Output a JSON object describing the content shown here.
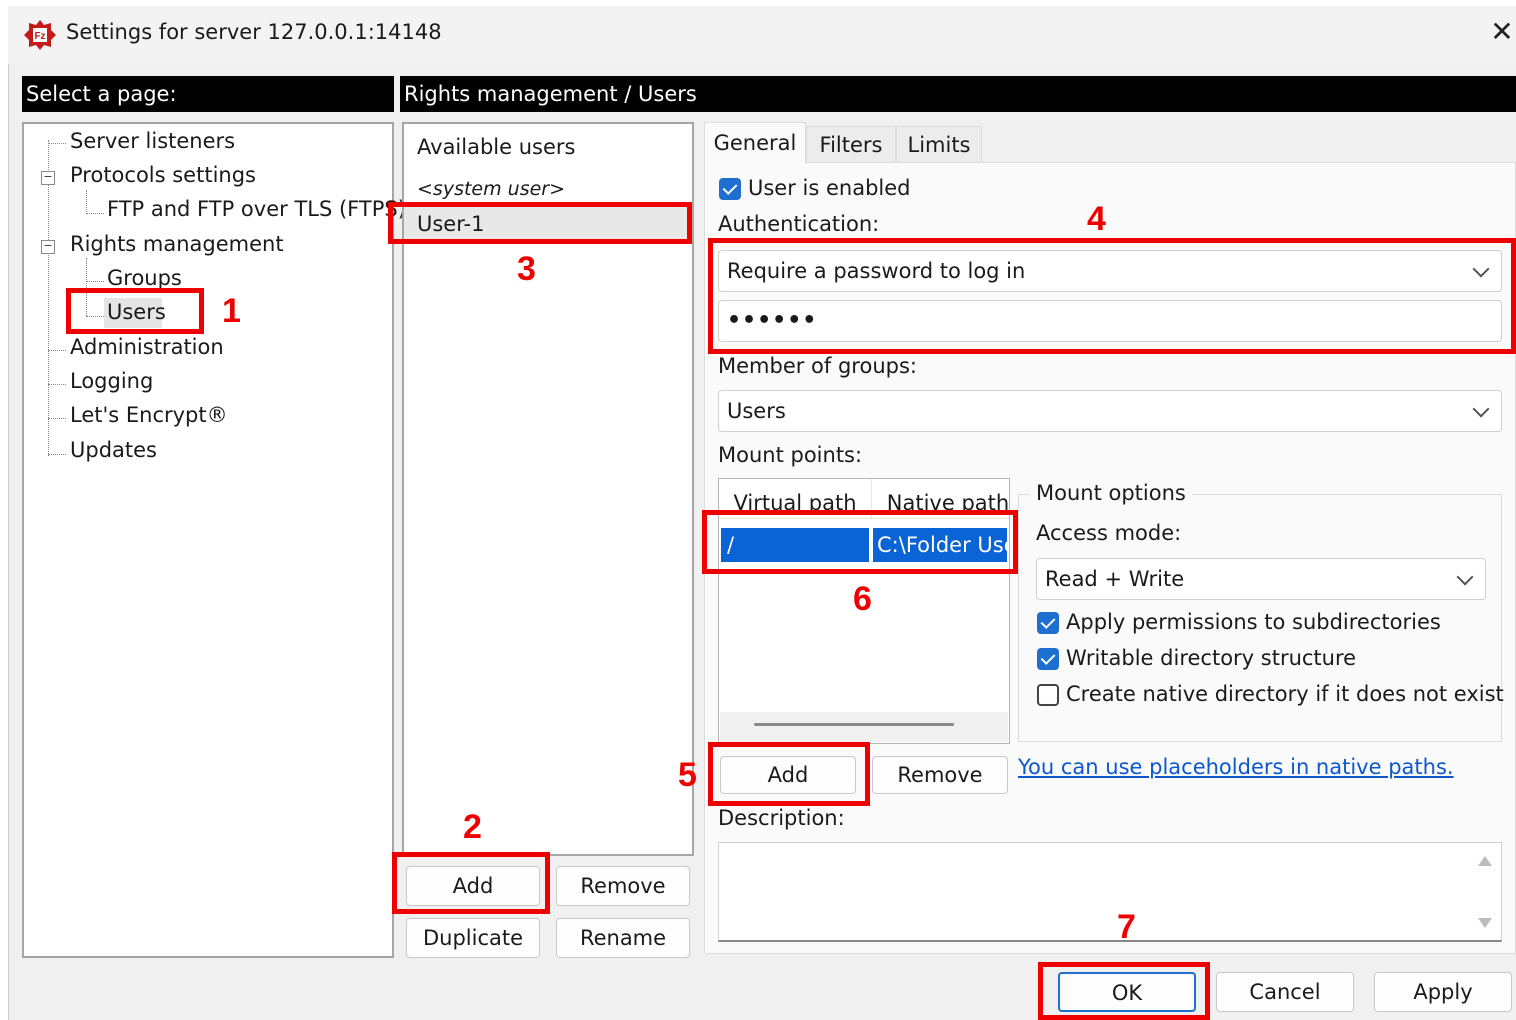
{
  "window": {
    "title": "Settings for server 127.0.0.1:14148"
  },
  "left_header": "Select a page:",
  "right_header": "Rights management / Users",
  "tree": {
    "server_listeners": "Server listeners",
    "protocols_settings": "Protocols settings",
    "ftp_tls": "FTP and FTP over TLS (FTPS)",
    "rights_management": "Rights management",
    "groups": "Groups",
    "users": "Users",
    "administration": "Administration",
    "logging": "Logging",
    "lets_encrypt": "Let's Encrypt®",
    "updates": "Updates"
  },
  "users_list": {
    "header": "Available users",
    "items": [
      "<system user>",
      "User-1"
    ],
    "selected": "User-1",
    "buttons": {
      "add": "Add",
      "remove": "Remove",
      "duplicate": "Duplicate",
      "rename": "Rename"
    }
  },
  "tabs": [
    "General",
    "Filters",
    "Limits"
  ],
  "general": {
    "user_enabled_label": "User is enabled",
    "user_enabled": true,
    "auth_label": "Authentication:",
    "auth_value": "Require a password to log in",
    "password_mask": "••••••",
    "groups_label": "Member of groups:",
    "groups_value": "Users",
    "mount_points_label": "Mount points:",
    "mount_table": {
      "columns": [
        "Virtual path",
        "Native path"
      ],
      "rows": [
        {
          "virtual": "/",
          "native": "C:\\Folder Use"
        }
      ]
    },
    "mount_options": {
      "title": "Mount options",
      "access_mode_label": "Access mode:",
      "access_mode": "Read + Write",
      "apply_subdirs_label": "Apply permissions to subdirectories",
      "apply_subdirs": true,
      "writable_label": "Writable directory structure",
      "writable": true,
      "create_native_label": "Create native directory if it does not exist",
      "create_native": false
    },
    "mount_buttons": {
      "add": "Add",
      "remove": "Remove"
    },
    "placeholders_link": "You can use placeholders in native paths.",
    "description_label": "Description:"
  },
  "footer_buttons": {
    "ok": "OK",
    "cancel": "Cancel",
    "apply": "Apply"
  },
  "annotations": [
    "1",
    "2",
    "3",
    "4",
    "5",
    "6",
    "7"
  ],
  "colors": {
    "annotation": "#ee0000",
    "accent": "#1e6fd0",
    "selection": "#0a64d6"
  }
}
